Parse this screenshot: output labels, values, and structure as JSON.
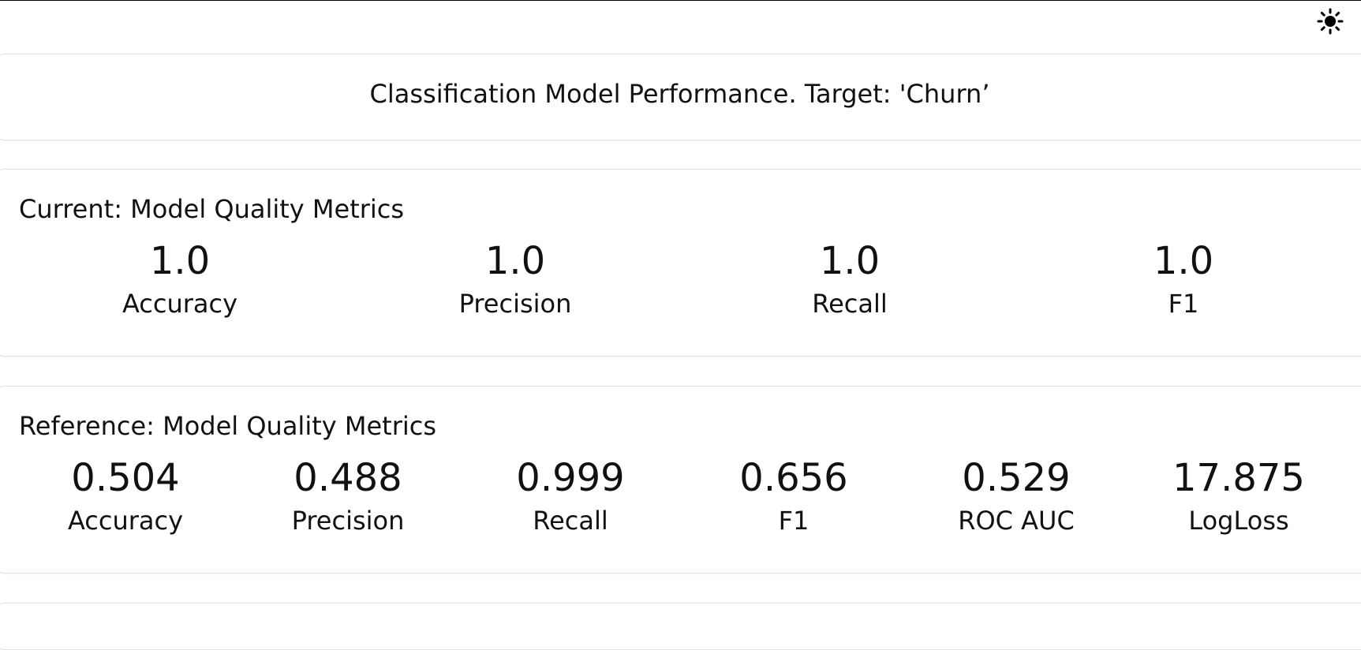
{
  "header": {
    "title": "Classification Model Performance. Target: 'Churn’"
  },
  "theme_toggle": {
    "icon": "sun-icon"
  },
  "current": {
    "title": "Current: Model Quality Metrics",
    "metrics": [
      {
        "value": "1.0",
        "label": "Accuracy"
      },
      {
        "value": "1.0",
        "label": "Precision"
      },
      {
        "value": "1.0",
        "label": "Recall"
      },
      {
        "value": "1.0",
        "label": "F1"
      }
    ]
  },
  "reference": {
    "title": "Reference: Model Quality Metrics",
    "metrics": [
      {
        "value": "0.504",
        "label": "Accuracy"
      },
      {
        "value": "0.488",
        "label": "Precision"
      },
      {
        "value": "0.999",
        "label": "Recall"
      },
      {
        "value": "0.656",
        "label": "F1"
      },
      {
        "value": "0.529",
        "label": "ROC AUC"
      },
      {
        "value": "17.875",
        "label": "LogLoss"
      }
    ]
  }
}
